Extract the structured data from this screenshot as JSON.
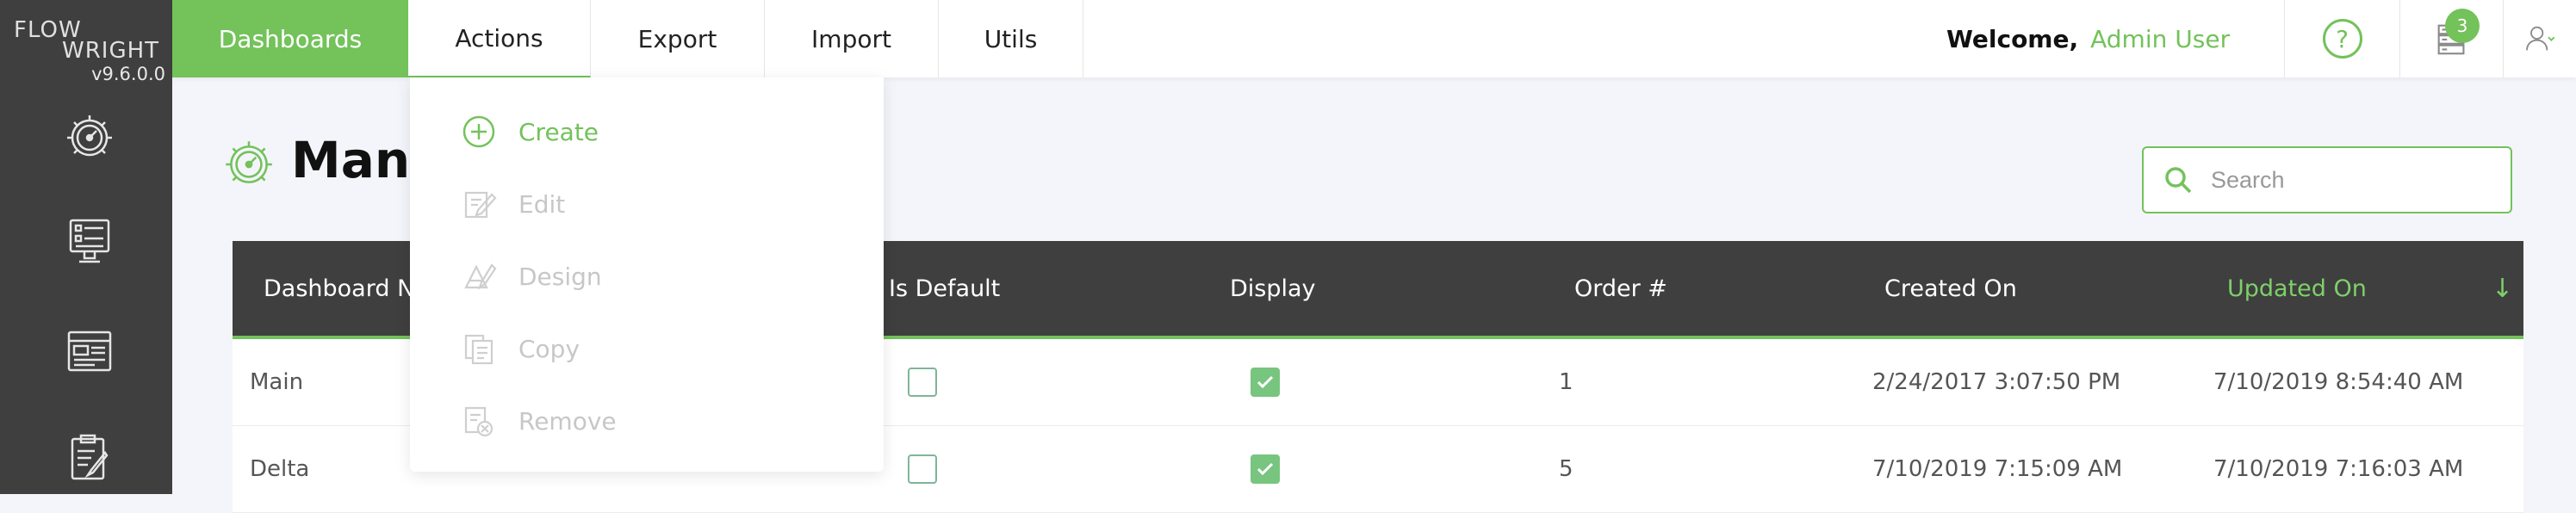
{
  "app": {
    "logo_line1": "FLOW",
    "logo_line2": "WRIGHT",
    "version": "v9.6.0.0"
  },
  "rail": {
    "icons": [
      "dashboard-gauge-icon",
      "monitor-checklist-icon",
      "window-form-icon",
      "clipboard-edit-icon"
    ]
  },
  "topnav": {
    "tabs": [
      "Dashboards",
      "Actions",
      "Export",
      "Import",
      "Utils"
    ],
    "welcome_label": "Welcome,",
    "user_name": "Admin User",
    "help_glyph": "?",
    "notifications_count": "3"
  },
  "page": {
    "title": "Mana"
  },
  "search": {
    "placeholder": "Search",
    "value": ""
  },
  "actions_menu": {
    "items": [
      {
        "label": "Create",
        "enabled": true,
        "icon": "plus-circle-icon"
      },
      {
        "label": "Edit",
        "enabled": false,
        "icon": "edit-icon"
      },
      {
        "label": "Design",
        "enabled": false,
        "icon": "design-icon"
      },
      {
        "label": "Copy",
        "enabled": false,
        "icon": "copy-icon"
      },
      {
        "label": "Remove",
        "enabled": false,
        "icon": "remove-icon"
      }
    ]
  },
  "table": {
    "columns": [
      "Dashboard N",
      "Is Default",
      "Display",
      "Order #",
      "Created On",
      "Updated On"
    ],
    "sorted_column": "Updated On",
    "sort_direction": "descending",
    "rows": [
      {
        "name": "Main",
        "is_default": false,
        "display": true,
        "order": "1",
        "created_on": "2/24/2017 3:07:50 PM",
        "updated_on": "7/10/2019 8:54:40 AM"
      },
      {
        "name": "Delta",
        "is_default": false,
        "display": true,
        "order": "5",
        "created_on": "7/10/2019 7:15:09 AM",
        "updated_on": "7/10/2019 7:16:03 AM"
      }
    ]
  },
  "colors": {
    "accent": "#73c25a",
    "rail_bg": "#3f3f3f",
    "header_bg": "#3f3f3f",
    "page_bg": "#f4f5fa"
  }
}
